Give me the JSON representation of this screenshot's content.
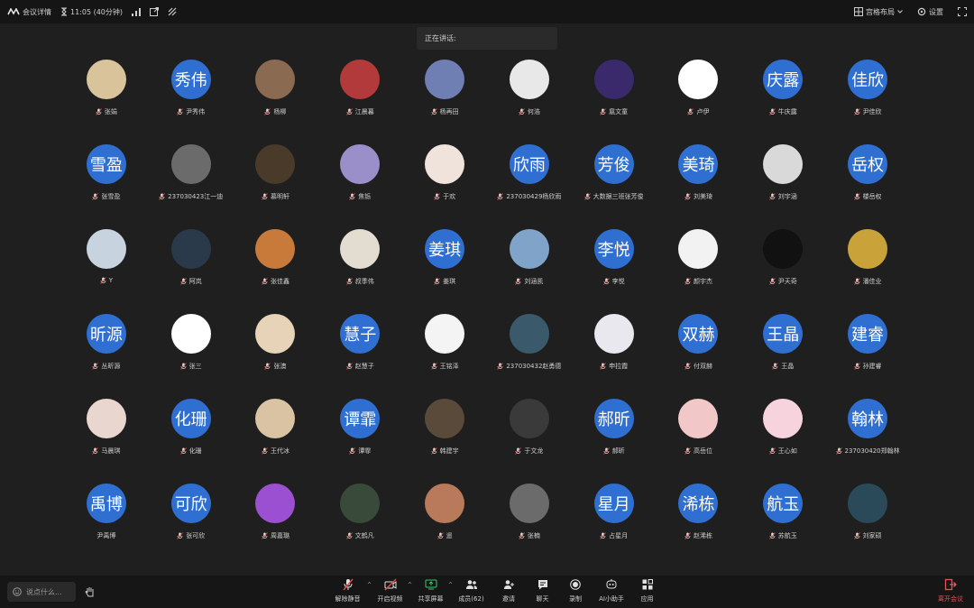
{
  "topbar": {
    "meeting_details": "会议详情",
    "time": "11:05 (40分钟)",
    "layout": "宫格布局",
    "settings": "设置"
  },
  "speaking_label": "正在讲话:",
  "participants": [
    {
      "name": "张娟",
      "label": "",
      "color": "#d9c39b"
    },
    {
      "name": "尹秀伟",
      "label": "秀伟",
      "color": "#2f6fd1"
    },
    {
      "name": "杨柳",
      "label": "",
      "color": "#8a6b52"
    },
    {
      "name": "江晨暮",
      "label": "",
      "color": "#b23a3a"
    },
    {
      "name": "杨再田",
      "label": "",
      "color": "#6f7fb3"
    },
    {
      "name": "何浩",
      "label": "",
      "color": "#e8e8e8"
    },
    {
      "name": "扈文童",
      "label": "",
      "color": "#3a2a6b"
    },
    {
      "name": "卢伊",
      "label": "",
      "color": "#ffffff"
    },
    {
      "name": "牛庆露",
      "label": "庆露",
      "color": "#2f6fd1"
    },
    {
      "name": "尹佳欣",
      "label": "佳欣",
      "color": "#2f6fd1"
    },
    {
      "name": "张雪盈",
      "label": "雪盈",
      "color": "#2f6fd1"
    },
    {
      "name": "237030423江一迪",
      "label": "",
      "color": "#6b6b6b"
    },
    {
      "name": "慕明轩",
      "label": "",
      "color": "#4a3a2a",
      "badge": true
    },
    {
      "name": "焦铄",
      "label": "",
      "color": "#9a8fc9"
    },
    {
      "name": "于欢",
      "label": "",
      "color": "#f0e3dc"
    },
    {
      "name": "237030429杨欣雨",
      "label": "欣雨",
      "color": "#2f6fd1"
    },
    {
      "name": "大数据三班张芳俊",
      "label": "芳俊",
      "color": "#2f6fd1"
    },
    {
      "name": "刘美琦",
      "label": "美琦",
      "color": "#2f6fd1"
    },
    {
      "name": "刘宇涵",
      "label": "",
      "color": "#d9d9d9"
    },
    {
      "name": "楼岳权",
      "label": "岳权",
      "color": "#2f6fd1"
    },
    {
      "name": "Y",
      "label": "",
      "color": "#c7d4e0"
    },
    {
      "name": "阿岚",
      "label": "",
      "color": "#2a3a4a"
    },
    {
      "name": "张佳鑫",
      "label": "",
      "color": "#c77a3a"
    },
    {
      "name": "叔季伟",
      "label": "",
      "color": "#e3dcd0"
    },
    {
      "name": "姜琪",
      "label": "姜琪",
      "color": "#2f6fd1"
    },
    {
      "name": "刘涵凯",
      "label": "",
      "color": "#7fa3c9"
    },
    {
      "name": "李悦",
      "label": "李悦",
      "color": "#2f6fd1"
    },
    {
      "name": "颜宇杰",
      "label": "",
      "color": "#f2f2f2"
    },
    {
      "name": "尹天奇",
      "label": "",
      "color": "#111111"
    },
    {
      "name": "潘佳业",
      "label": "",
      "color": "#c9a33a"
    },
    {
      "name": "丛昕源",
      "label": "昕源",
      "color": "#2f6fd1"
    },
    {
      "name": "张三",
      "label": "",
      "color": "#ffffff"
    },
    {
      "name": "张澳",
      "label": "",
      "color": "#e6d3b8"
    },
    {
      "name": "赵慧子",
      "label": "慧子",
      "color": "#2f6fd1"
    },
    {
      "name": "王铭泽",
      "label": "",
      "color": "#f4f4f4"
    },
    {
      "name": "237030432赵勇德",
      "label": "",
      "color": "#3a5a6b"
    },
    {
      "name": "申拉霞",
      "label": "",
      "color": "#e8e8ee"
    },
    {
      "name": "付双赫",
      "label": "双赫",
      "color": "#2f6fd1"
    },
    {
      "name": "王晶",
      "label": "王晶",
      "color": "#2f6fd1"
    },
    {
      "name": "孙建睿",
      "label": "建睿",
      "color": "#2f6fd1"
    },
    {
      "name": "马晨琪",
      "label": "",
      "color": "#e9d6cf"
    },
    {
      "name": "化珊",
      "label": "化珊",
      "color": "#2f6fd1"
    },
    {
      "name": "王代冰",
      "label": "",
      "color": "#d9c3a3"
    },
    {
      "name": "谭霏",
      "label": "谭霏",
      "color": "#2f6fd1"
    },
    {
      "name": "韩建宇",
      "label": "",
      "color": "#5a4a3a"
    },
    {
      "name": "于文龙",
      "label": "",
      "color": "#3a3a3a"
    },
    {
      "name": "郝昕",
      "label": "郝昕",
      "color": "#2f6fd1"
    },
    {
      "name": "高岳位",
      "label": "",
      "color": "#f2c7c7"
    },
    {
      "name": "王心如",
      "label": "",
      "color": "#f7d3de"
    },
    {
      "name": "237030420郑翰林",
      "label": "翰林",
      "color": "#2f6fd1"
    },
    {
      "name": "尹禹博",
      "label": "禹博",
      "color": "#2f6fd1",
      "no_mic": true
    },
    {
      "name": "张可欣",
      "label": "可欣",
      "color": "#2f6fd1"
    },
    {
      "name": "周嘉璐",
      "label": "",
      "color": "#9b4fd1"
    },
    {
      "name": "文鹤凡",
      "label": "",
      "color": "#3a4a3a"
    },
    {
      "name": "遥",
      "label": "",
      "color": "#b87a5a"
    },
    {
      "name": "张楠",
      "label": "",
      "color": "#6b6b6b"
    },
    {
      "name": "占星月",
      "label": "星月",
      "color": "#2f6fd1"
    },
    {
      "name": "赵浠栋",
      "label": "浠栋",
      "color": "#2f6fd1"
    },
    {
      "name": "苏航玉",
      "label": "航玉",
      "color": "#2f6fd1"
    },
    {
      "name": "刘家硕",
      "label": "",
      "color": "#2a4a5a"
    }
  ],
  "bottombar": {
    "chat_placeholder": "说点什么...",
    "controls": [
      {
        "key": "unmute",
        "label": "解除静音"
      },
      {
        "key": "video",
        "label": "开启视频"
      },
      {
        "key": "share",
        "label": "共享屏幕"
      },
      {
        "key": "members",
        "label": "成员(62)"
      },
      {
        "key": "invite",
        "label": "邀请"
      },
      {
        "key": "chat",
        "label": "聊天"
      },
      {
        "key": "record",
        "label": "录制"
      },
      {
        "key": "ai",
        "label": "AI小助手"
      },
      {
        "key": "apps",
        "label": "应用"
      }
    ],
    "leave": "离开会议"
  }
}
